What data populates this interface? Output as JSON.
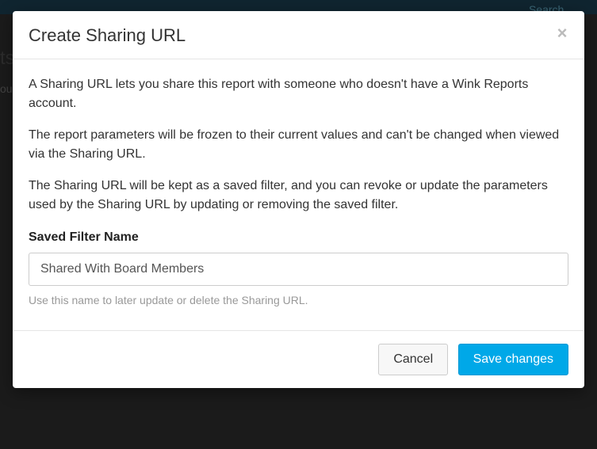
{
  "background": {
    "search_placeholder": "Search...",
    "left_fragment_1": "ts",
    "left_fragment_2": "ou"
  },
  "modal": {
    "title": "Create Sharing URL",
    "close_glyph": "×",
    "paragraphs": {
      "p1": "A Sharing URL lets you share this report with someone who doesn't have a Wink Reports account.",
      "p2": "The report parameters will be frozen to their current values and can't be changed when viewed via the Sharing URL.",
      "p3": "The Sharing URL will be kept as a saved filter, and you can revoke or update the parameters used by the Sharing URL by updating or removing the saved filter."
    },
    "field": {
      "label": "Saved Filter Name",
      "value": "Shared With Board Members",
      "help": "Use this name to later update or delete the Sharing URL."
    },
    "buttons": {
      "cancel": "Cancel",
      "save": "Save changes"
    }
  }
}
